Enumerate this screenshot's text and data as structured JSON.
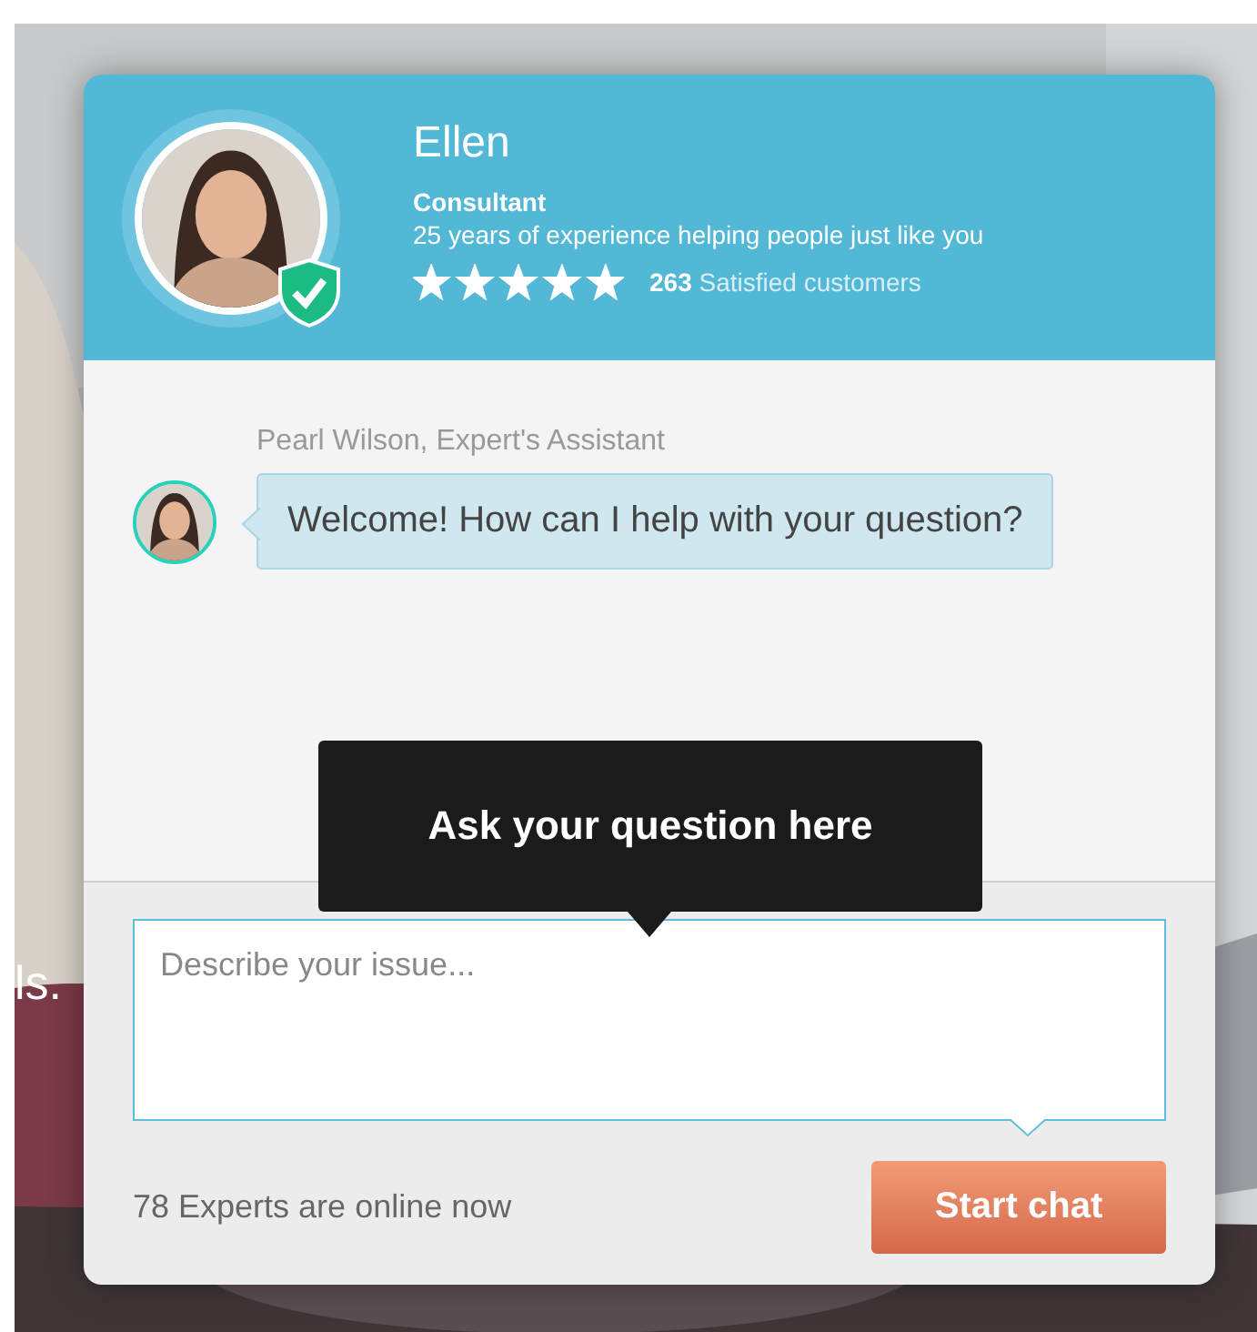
{
  "page": {
    "side_text": "ls."
  },
  "expert": {
    "name": "Ellen",
    "title": "Consultant",
    "bio": "25 years of experience helping people just like you",
    "verified": true,
    "stars": 5,
    "customers_count": "263",
    "customers_label": "Satisfied customers"
  },
  "chat": {
    "messages": [
      {
        "sender": "Pearl Wilson, Expert's Assistant",
        "text": "Welcome! How can I help with your question?"
      }
    ]
  },
  "tooltip": "Ask your question here",
  "question": {
    "placeholder": "Describe your issue..."
  },
  "footer": {
    "online": "78 Experts are online now",
    "button": "Start chat"
  }
}
